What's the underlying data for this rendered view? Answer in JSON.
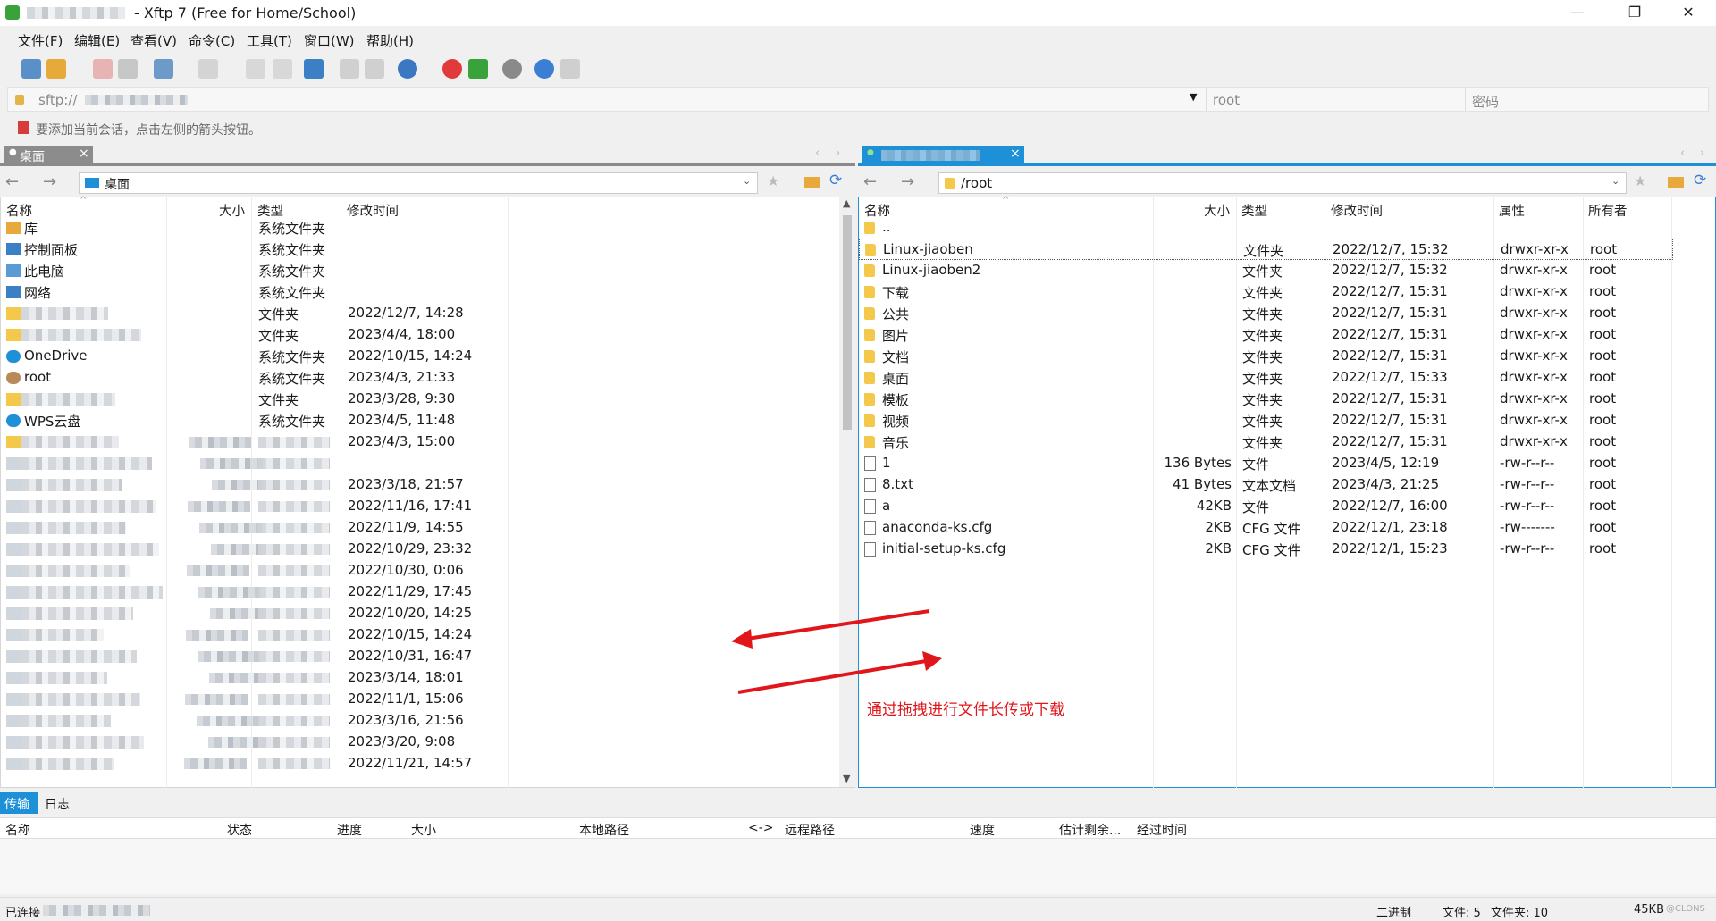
{
  "window": {
    "title": "- Xftp 7 (Free for Home/School)",
    "minimize": "—",
    "maximize": "❐",
    "close": "✕"
  },
  "menu": [
    "文件(F)",
    "编辑(E)",
    "查看(V)",
    "命令(C)",
    "工具(T)",
    "窗口(W)",
    "帮助(H)"
  ],
  "address": {
    "host_prefix": "sftp://",
    "user": "root",
    "password_placeholder": "密码"
  },
  "hint": "要添加当前会话，点击左侧的箭头按钮。",
  "left_pane": {
    "tab_label": "桌面",
    "tab_close": "×",
    "path": "桌面",
    "columns": [
      "名称",
      "大小",
      "类型",
      "修改时间"
    ],
    "rows": [
      {
        "name": "库",
        "size": "",
        "type": "系统文件夹",
        "date": "",
        "icon": "library-icon"
      },
      {
        "name": "控制面板",
        "size": "",
        "type": "系统文件夹",
        "date": "",
        "icon": "control-panel-icon"
      },
      {
        "name": "此电脑",
        "size": "",
        "type": "系统文件夹",
        "date": "",
        "icon": "computer-icon"
      },
      {
        "name": "网络",
        "size": "",
        "type": "系统文件夹",
        "date": "",
        "icon": "network-icon"
      },
      {
        "name": "",
        "size": "",
        "type": "文件夹",
        "date": "2022/12/7, 14:28",
        "icon": "folder-icon"
      },
      {
        "name": "",
        "size": "",
        "type": "文件夹",
        "date": "2023/4/4, 18:00",
        "icon": "folder-icon"
      },
      {
        "name": "OneDrive",
        "size": "",
        "type": "系统文件夹",
        "date": "2022/10/15, 14:24",
        "icon": "cloud-icon"
      },
      {
        "name": "root",
        "size": "",
        "type": "系统文件夹",
        "date": "2023/4/3, 21:33",
        "icon": "user-icon"
      },
      {
        "name": "",
        "size": "",
        "type": "文件夹",
        "date": "2023/3/28, 9:30",
        "icon": "folder-icon"
      },
      {
        "name": "WPS云盘",
        "size": "",
        "type": "系统文件夹",
        "date": "2023/4/5, 11:48",
        "icon": "cloud-icon"
      },
      {
        "name": "",
        "size": "",
        "type": "",
        "date": "2023/4/3, 15:00",
        "icon": "folder-icon"
      },
      {
        "name": "",
        "size": "",
        "type": "",
        "date": "",
        "icon": "file-icon"
      },
      {
        "name": "",
        "size": "",
        "type": "",
        "date": "2023/3/18, 21:57",
        "icon": "file-icon"
      },
      {
        "name": "",
        "size": "",
        "type": "",
        "date": "2022/11/16, 17:41",
        "icon": "file-icon"
      },
      {
        "name": "",
        "size": "",
        "type": "",
        "date": "2022/11/9, 14:55",
        "icon": "file-icon"
      },
      {
        "name": "",
        "size": "",
        "type": "",
        "date": "2022/10/29, 23:32",
        "icon": "file-icon"
      },
      {
        "name": "",
        "size": "",
        "type": "",
        "date": "2022/10/30, 0:06",
        "icon": "file-icon"
      },
      {
        "name": "",
        "size": "",
        "type": "",
        "date": "2022/11/29, 17:45",
        "icon": "file-icon"
      },
      {
        "name": "",
        "size": "",
        "type": "",
        "date": "2022/10/20, 14:25",
        "icon": "file-icon"
      },
      {
        "name": "",
        "size": "",
        "type": "",
        "date": "2022/10/15, 14:24",
        "icon": "file-icon"
      },
      {
        "name": "",
        "size": "",
        "type": "",
        "date": "2022/10/31, 16:47",
        "icon": "file-icon"
      },
      {
        "name": "",
        "size": "",
        "type": "",
        "date": "2023/3/14, 18:01",
        "icon": "file-icon"
      },
      {
        "name": "",
        "size": "",
        "type": "",
        "date": "2022/11/1, 15:06",
        "icon": "file-icon"
      },
      {
        "name": "",
        "size": "",
        "type": "",
        "date": "2023/3/16, 21:56",
        "icon": "file-icon"
      },
      {
        "name": "",
        "size": "",
        "type": "",
        "date": "2023/3/20, 9:08",
        "icon": "file-icon"
      },
      {
        "name": "",
        "size": "",
        "type": "",
        "date": "2022/11/21, 14:57",
        "icon": "file-icon"
      }
    ]
  },
  "right_pane": {
    "tab_close": "×",
    "path": "/root",
    "columns": [
      "名称",
      "大小",
      "类型",
      "修改时间",
      "属性",
      "所有者"
    ],
    "rows": [
      {
        "name": "..",
        "size": "",
        "type": "",
        "date": "",
        "attr": "",
        "owner": "",
        "kind": "folder"
      },
      {
        "name": "Linux-jiaoben",
        "size": "",
        "type": "文件夹",
        "date": "2022/12/7, 15:32",
        "attr": "drwxr-xr-x",
        "owner": "root",
        "kind": "folder"
      },
      {
        "name": "Linux-jiaoben2",
        "size": "",
        "type": "文件夹",
        "date": "2022/12/7, 15:32",
        "attr": "drwxr-xr-x",
        "owner": "root",
        "kind": "folder"
      },
      {
        "name": "下载",
        "size": "",
        "type": "文件夹",
        "date": "2022/12/7, 15:31",
        "attr": "drwxr-xr-x",
        "owner": "root",
        "kind": "folder"
      },
      {
        "name": "公共",
        "size": "",
        "type": "文件夹",
        "date": "2022/12/7, 15:31",
        "attr": "drwxr-xr-x",
        "owner": "root",
        "kind": "folder"
      },
      {
        "name": "图片",
        "size": "",
        "type": "文件夹",
        "date": "2022/12/7, 15:31",
        "attr": "drwxr-xr-x",
        "owner": "root",
        "kind": "folder"
      },
      {
        "name": "文档",
        "size": "",
        "type": "文件夹",
        "date": "2022/12/7, 15:31",
        "attr": "drwxr-xr-x",
        "owner": "root",
        "kind": "folder"
      },
      {
        "name": "桌面",
        "size": "",
        "type": "文件夹",
        "date": "2022/12/7, 15:33",
        "attr": "drwxr-xr-x",
        "owner": "root",
        "kind": "folder"
      },
      {
        "name": "模板",
        "size": "",
        "type": "文件夹",
        "date": "2022/12/7, 15:31",
        "attr": "drwxr-xr-x",
        "owner": "root",
        "kind": "folder"
      },
      {
        "name": "视频",
        "size": "",
        "type": "文件夹",
        "date": "2022/12/7, 15:31",
        "attr": "drwxr-xr-x",
        "owner": "root",
        "kind": "folder"
      },
      {
        "name": "音乐",
        "size": "",
        "type": "文件夹",
        "date": "2022/12/7, 15:31",
        "attr": "drwxr-xr-x",
        "owner": "root",
        "kind": "folder"
      },
      {
        "name": "1",
        "size": "136 Bytes",
        "type": "文件",
        "date": "2023/4/5, 12:19",
        "attr": "-rw-r--r--",
        "owner": "root",
        "kind": "file"
      },
      {
        "name": "8.txt",
        "size": "41 Bytes",
        "type": "文本文档",
        "date": "2023/4/3, 21:25",
        "attr": "-rw-r--r--",
        "owner": "root",
        "kind": "file"
      },
      {
        "name": "a",
        "size": "42KB",
        "type": "文件",
        "date": "2022/12/7, 16:00",
        "attr": "-rw-r--r--",
        "owner": "root",
        "kind": "file"
      },
      {
        "name": "anaconda-ks.cfg",
        "size": "2KB",
        "type": "CFG 文件",
        "date": "2022/12/1, 23:18",
        "attr": "-rw-------",
        "owner": "root",
        "kind": "file"
      },
      {
        "name": "initial-setup-ks.cfg",
        "size": "2KB",
        "type": "CFG 文件",
        "date": "2022/12/1, 15:23",
        "attr": "-rw-r--r--",
        "owner": "root",
        "kind": "file"
      }
    ]
  },
  "annotation": "通过拖拽进行文件长传或下载",
  "transfer": {
    "tabs": [
      "传输",
      "日志"
    ],
    "columns": [
      "名称",
      "状态",
      "进度",
      "大小",
      "本地路径",
      "<->",
      "远程路径",
      "速度",
      "估计剩余...",
      "经过时间"
    ]
  },
  "status": {
    "connected": "已连接",
    "mode": "二进制",
    "files": "文件: 5",
    "folders": "文件夹: 10",
    "speed": "45KB",
    "watermark": "@CLONS"
  },
  "colors": {
    "accent": "#1e90d8",
    "annotation": "#e0161b",
    "folder": "#f4c84a"
  }
}
